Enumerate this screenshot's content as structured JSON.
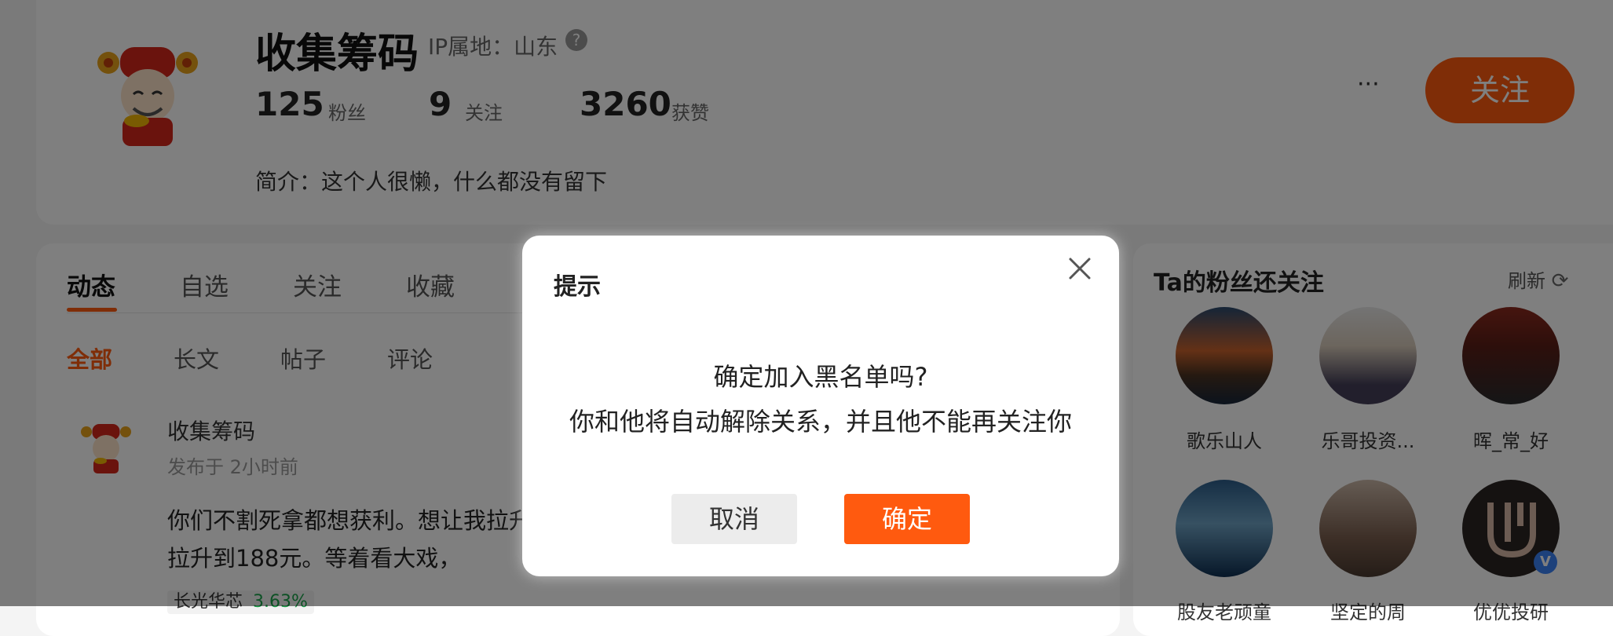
{
  "profile": {
    "name": "收集筹码",
    "ip_location": "IP属地：山东",
    "stats": [
      {
        "value": "125",
        "label": "粉丝"
      },
      {
        "value": "9",
        "label": "关注"
      },
      {
        "value": "3260",
        "label": "获赞"
      }
    ],
    "bio": "简介：这个人很懒，什么都没有留下",
    "more_label": "···",
    "follow_label": "关注"
  },
  "tabs": [
    "动态",
    "自选",
    "关注",
    "收藏"
  ],
  "subtabs": [
    "全部",
    "长文",
    "帖子",
    "评论"
  ],
  "post": {
    "author": "收集筹码",
    "time": "发布于 2小时前",
    "line1": "你们不割死拿都想获利。想让我拉升",
    "line2": "拉升到188元。等着看大戏，",
    "stock_name": "长光华芯",
    "stock_change": "3.63%"
  },
  "sidebar": {
    "title": "Ta的粉丝还关注",
    "refresh_label": "刷新",
    "users": [
      {
        "name": "歌乐山人"
      },
      {
        "name": "乐哥投资..."
      },
      {
        "name": "晖_常_好"
      },
      {
        "name": "股友老顽童"
      },
      {
        "name": "坚定的周"
      },
      {
        "name": "优优投研"
      }
    ]
  },
  "dialog": {
    "title": "提示",
    "message_line1": "确定加入黑名单吗?",
    "message_line2": "你和他将自动解除关系，并且他不能再关注你",
    "cancel_label": "取消",
    "confirm_label": "确定"
  },
  "colors": {
    "accent": "#ff5a0f",
    "green": "#1aa34a"
  }
}
